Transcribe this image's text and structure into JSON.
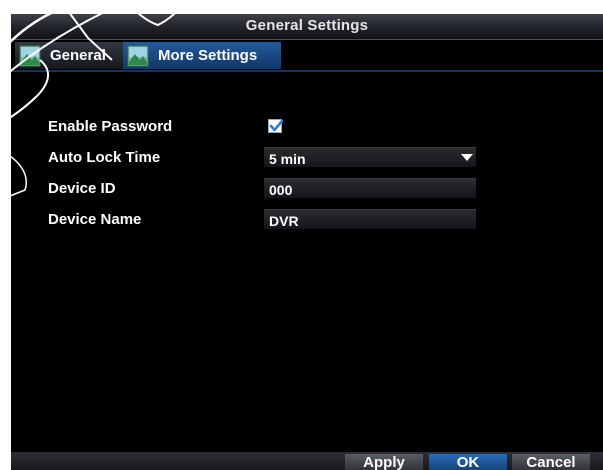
{
  "window": {
    "title": "General Settings"
  },
  "tabs": [
    {
      "label": "General",
      "icon": "landscape-image-icon",
      "active": false
    },
    {
      "label": "More Settings",
      "icon": "landscape-image-icon",
      "active": true
    }
  ],
  "settings": {
    "enable_password": {
      "label": "Enable Password",
      "checked": true
    },
    "auto_lock_time": {
      "label": "Auto Lock Time",
      "value": "5 min"
    },
    "device_id": {
      "label": "Device ID",
      "value": "000"
    },
    "device_name": {
      "label": "Device Name",
      "value": "DVR"
    }
  },
  "buttons": {
    "apply": "Apply",
    "ok": "OK",
    "cancel": "Cancel"
  },
  "colors": {
    "active_tab": "#1f4f8a",
    "ok_button": "#1e5aa0",
    "background": "#000000",
    "checkbox_check": "#2a7fd4"
  }
}
